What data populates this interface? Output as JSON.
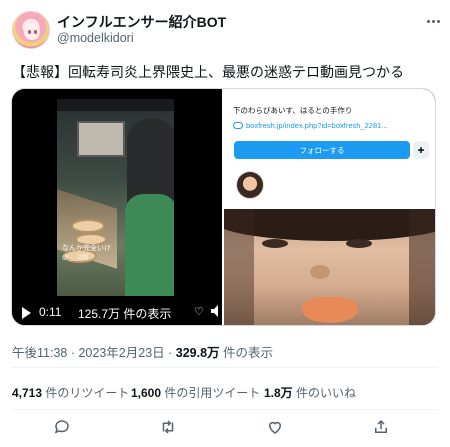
{
  "author": {
    "name": "インフルエンサー紹介BOT",
    "handle": "@modelkidori",
    "avatar_icon": "anime-character-avatar"
  },
  "more_icon": "ellipsis-icon",
  "tweet_text": "【悲報】回転寿司炎上界隈史上、最悪の迷惑テロ動画見つかる",
  "media": {
    "video": {
      "overlay_line1": "なんか完全いけ",
      "overlay_line2": "@___233",
      "time": "0:11",
      "views": "125.7万 件の表示",
      "gif_label": "♡"
    },
    "profile_card": {
      "bio": "下のわらびあいす、はるとの手作り",
      "link": "boxfresh.jp/index.php?id=boxfresh_2281...",
      "follow_label": "フォローする",
      "add_icon": "add-friend-icon"
    }
  },
  "meta": {
    "time": "午後11:38",
    "date": "2023年2月23日",
    "views_count": "329.8万",
    "views_label": "件の表示"
  },
  "stats": {
    "retweets_count": "4,713",
    "retweets_label": "件のリツイート",
    "quotes_count": "1,600",
    "quotes_label": "件の引用ツイート",
    "likes_count": "1.8万",
    "likes_label": "件のいいね"
  },
  "actions": [
    "reply-icon",
    "retweet-icon",
    "like-icon",
    "share-icon"
  ],
  "colors": {
    "accent": "#1d9bf0",
    "text": "#0f1419",
    "secondary": "#536471"
  }
}
